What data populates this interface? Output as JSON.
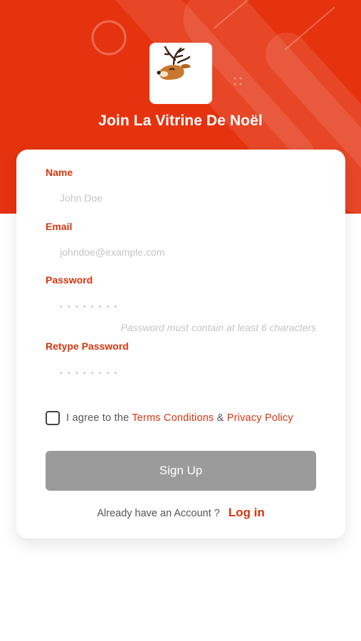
{
  "header": {
    "title": "Join La Vitrine De Noël",
    "logo": "deer-logo-icon"
  },
  "form": {
    "name_label": "Name",
    "name_placeholder": "John Doe",
    "email_label": "Email",
    "email_placeholder": "johndoe@example.com",
    "password_label": "Password",
    "password_placeholder": "• • • • • • • •",
    "password_hint": "Password must contain at least 6 characters",
    "retype_label": "Retype Password",
    "retype_placeholder": "• • • • • • • •"
  },
  "agreement": {
    "prefix": "I agree to the",
    "terms_link": "Terms Conditions",
    "joiner": "&",
    "privacy_link": "Privacy Policy",
    "checked": false
  },
  "actions": {
    "signup_label": "Sign Up",
    "have_account_text": "Already have an Account ?",
    "login_label": "Log in"
  },
  "colors": {
    "accent": "#e5330f",
    "label": "#d8350f",
    "button_disabled": "#9b9b9b"
  }
}
